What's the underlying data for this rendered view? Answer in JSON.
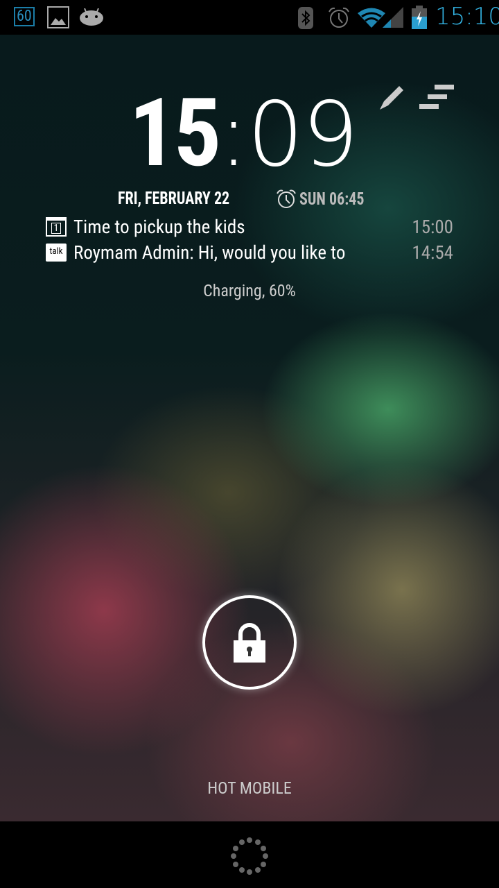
{
  "status_bar": {
    "badge": "60",
    "time": "15:10",
    "accent": "#33b5e5"
  },
  "lockscreen": {
    "clock_hours": "15",
    "clock_sep": ":",
    "clock_minutes": "09",
    "date": "FRI, FEBRUARY 22",
    "alarm": "SUN 06:45",
    "notifications": [
      {
        "icon": "calendar-icon",
        "calendar_day": "1",
        "text": "Time to pickup the kids",
        "time": "15:00"
      },
      {
        "icon": "talk-icon",
        "icon_label": "talk",
        "text": "Roymam Admin: Hi, would you like to",
        "time": "14:54"
      }
    ],
    "charging": "Charging, 60%",
    "carrier": "HOT MOBILE"
  }
}
